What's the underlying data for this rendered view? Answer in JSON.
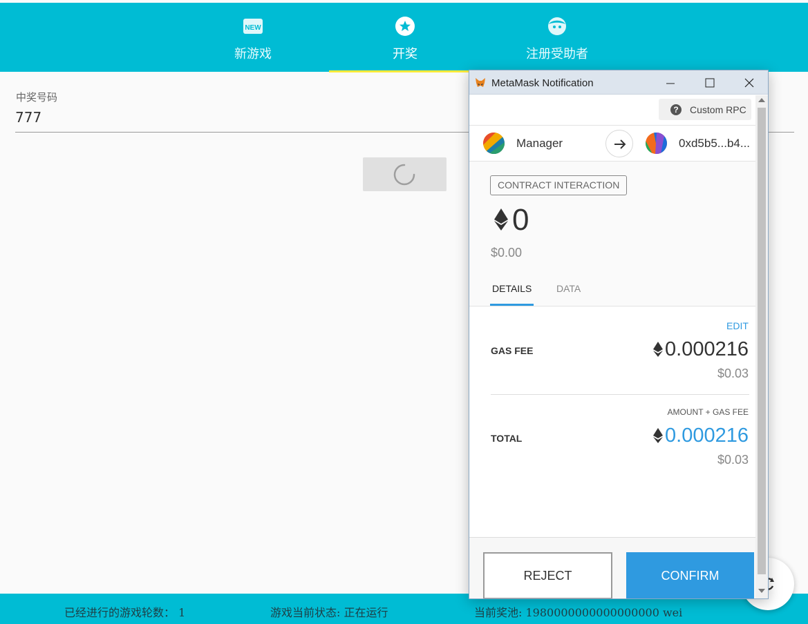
{
  "tabs": [
    {
      "label": "新游戏",
      "icon": "new-badge-icon"
    },
    {
      "label": "开奖",
      "icon": "star-circle-icon"
    },
    {
      "label": "注册受助者",
      "icon": "face-icon"
    }
  ],
  "colors": {
    "primary": "#00bcd4",
    "indicator": "#ffeb3b",
    "metamask_blue": "#2f9ae0"
  },
  "main": {
    "field_label": "中奖号码",
    "field_value": "777",
    "button_state": "loading"
  },
  "status_bar": {
    "rounds": "已经进行的游戏轮数： 1",
    "state": "游戏当前状态: 正在运行",
    "pool": "当前奖池: 1980000000000000000 wei"
  },
  "metamask": {
    "window_title": "MetaMask Notification",
    "network": "Custom RPC",
    "from_account": "Manager",
    "to_account": "0xd5b5...b4...",
    "badge": "CONTRACT INTERACTION",
    "amount": "0",
    "amount_usd": "$0.00",
    "tabs": [
      "DETAILS",
      "DATA"
    ],
    "edit_label": "EDIT",
    "gas_fee_label": "GAS FEE",
    "gas_fee_value": "0.000216",
    "gas_fee_usd": "$0.03",
    "total_sub_label": "AMOUNT + GAS FEE",
    "total_label": "TOTAL",
    "total_value": "0.000216",
    "total_usd": "$0.03",
    "reject_label": "REJECT",
    "confirm_label": "CONFIRM"
  }
}
